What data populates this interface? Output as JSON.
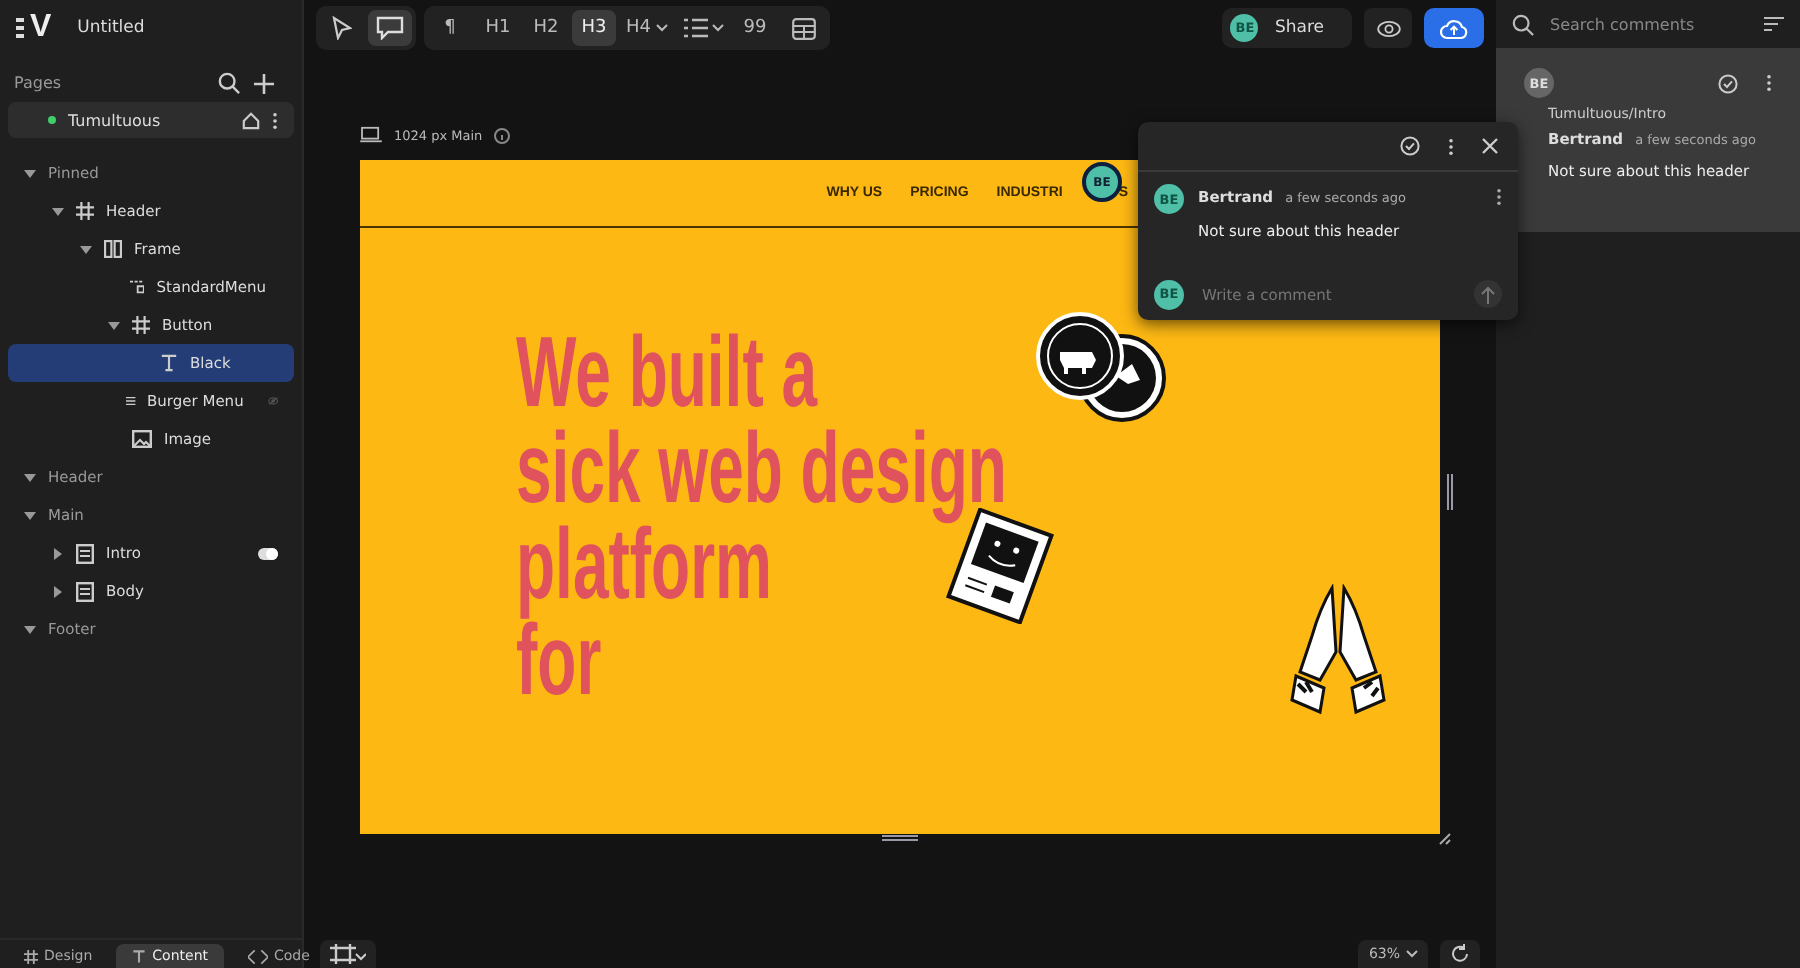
{
  "app": {
    "logo": "V",
    "title": "Untitled"
  },
  "toolbar": {
    "modes": [
      {
        "kind": "pointer",
        "selected": false
      },
      {
        "kind": "comment",
        "selected": true
      }
    ],
    "format": [
      {
        "kind": "text",
        "label": "¶",
        "selected": false,
        "caret": false
      },
      {
        "kind": "text",
        "label": "H1",
        "selected": false,
        "caret": false
      },
      {
        "kind": "text",
        "label": "H2",
        "selected": false,
        "caret": false
      },
      {
        "kind": "text",
        "label": "H3",
        "selected": true,
        "caret": false
      },
      {
        "kind": "text",
        "label": "H4",
        "selected": false,
        "caret": true
      },
      {
        "kind": "list",
        "selected": false,
        "caret": true
      },
      {
        "kind": "text",
        "label": "99",
        "selected": false,
        "caret": false
      },
      {
        "kind": "table",
        "selected": false,
        "caret": false
      }
    ],
    "share": {
      "avatar": "BE",
      "label": "Share"
    }
  },
  "pages": {
    "title": "Pages",
    "items": [
      {
        "label": "Tumultuous",
        "selected": true
      }
    ]
  },
  "tree": [
    {
      "label": "Pinned",
      "kind": "group",
      "expanded": true,
      "selected": false,
      "children": [
        {
          "label": "Header",
          "kind": "frame",
          "expanded": true,
          "selected": false,
          "children": [
            {
              "label": "Frame",
              "kind": "columns",
              "expanded": true,
              "selected": false,
              "children": [
                {
                  "label": "StandardMenu",
                  "kind": "component",
                  "selected": false
                },
                {
                  "label": "Button",
                  "kind": "frame",
                  "expanded": true,
                  "selected": false,
                  "children": [
                    {
                      "label": "Black",
                      "kind": "text",
                      "selected": true
                    }
                  ]
                },
                {
                  "label": "Burger Menu",
                  "kind": "menu",
                  "selected": false,
                  "hidden": true
                },
                {
                  "label": "Image",
                  "kind": "image",
                  "selected": false
                }
              ]
            }
          ]
        }
      ]
    },
    {
      "label": "Header",
      "kind": "group",
      "expanded": true,
      "selected": false
    },
    {
      "label": "Main",
      "kind": "group",
      "expanded": true,
      "selected": false,
      "children": [
        {
          "label": "Intro",
          "kind": "section",
          "expanded": false,
          "selected": false,
          "toggle": {
            "on": true
          }
        },
        {
          "label": "Body",
          "kind": "section",
          "expanded": false,
          "selected": false
        }
      ]
    },
    {
      "label": "Footer",
      "kind": "group",
      "expanded": true,
      "selected": false
    }
  ],
  "bottom_tabs": [
    {
      "label": "Design",
      "kind": "design",
      "selected": false
    },
    {
      "label": "Content",
      "kind": "content",
      "selected": true
    },
    {
      "label": "Code",
      "kind": "code",
      "selected": false
    }
  ],
  "canvas": {
    "frame_label": "1024 px Main",
    "nav": [
      "WHY US",
      "PRICING",
      "INDUSTRI",
      "S"
    ],
    "cursor_avatar": "BE",
    "heading": [
      "We built a",
      "sick web design",
      "platform",
      "for"
    ],
    "zoom": "63%"
  },
  "popup": {
    "author": {
      "avatar": "BE",
      "name": "Bertrand",
      "time": "a few seconds ago"
    },
    "text": "Not sure about this header",
    "reply": {
      "avatar": "BE",
      "placeholder": "Write a comment"
    }
  },
  "comments": {
    "search": {
      "placeholder": "Search comments"
    },
    "items": [
      {
        "avatar": "BE",
        "path": "Tumultuous/Intro",
        "name": "Bertrand",
        "time": "a few seconds ago",
        "text": "Not sure about this header",
        "selected": true
      }
    ]
  }
}
